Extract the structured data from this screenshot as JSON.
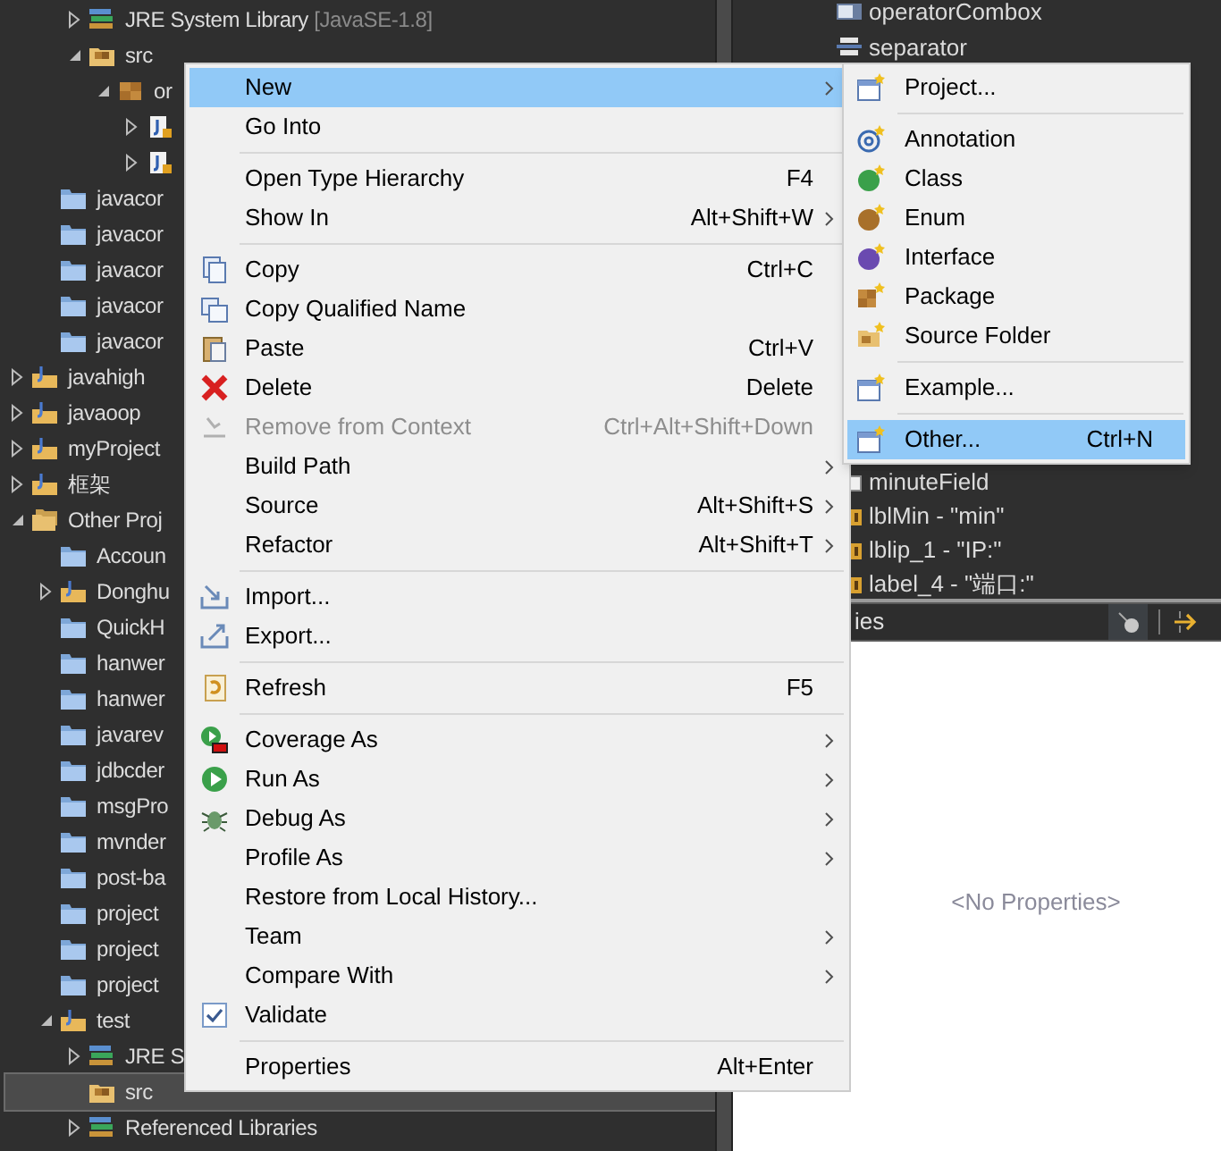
{
  "package_explorer": {
    "tree": [
      {
        "children": [
          {
            "children": [
              {
                "kind": "library",
                "label": "JRE System Library",
                "decoration": "[JavaSE-1.8]",
                "expanded": false,
                "selected": false
              },
              {
                "kind": "source-folder",
                "label": "src",
                "expanded": true,
                "selected": false,
                "children": [
                  {
                    "kind": "package",
                    "label": "or",
                    "expanded": true,
                    "selected": false,
                    "children": [
                      {
                        "kind": "file",
                        "expanded": false,
                        "selected": false
                      },
                      {
                        "kind": "file",
                        "expanded": false,
                        "selected": false
                      }
                    ]
                  }
                ]
              }
            ]
          },
          {
            "kind": "folder",
            "label": "javacor",
            "selected": false
          },
          {
            "kind": "folder",
            "label": "javacor",
            "selected": false
          },
          {
            "kind": "folder",
            "label": "javacor",
            "selected": false
          },
          {
            "kind": "folder",
            "label": "javacor",
            "selected": false
          },
          {
            "kind": "folder",
            "label": "javacor",
            "selected": false
          }
        ]
      },
      {
        "kind": "project",
        "label": "javahigh",
        "expanded": false,
        "selected": false
      },
      {
        "kind": "project",
        "label": "javaoop",
        "expanded": false,
        "selected": false
      },
      {
        "kind": "project",
        "label": "myProject",
        "expanded": false,
        "selected": false
      },
      {
        "kind": "project",
        "label": "框架",
        "expanded": false,
        "selected": false
      },
      {
        "kind": "working-set",
        "label": "Other Proj",
        "expanded": true,
        "selected": false,
        "children": [
          {
            "kind": "folder",
            "label": "Accoun",
            "selected": false
          },
          {
            "kind": "project",
            "label": "Donghu",
            "expanded": false,
            "selected": false
          },
          {
            "kind": "folder",
            "label": "QuickH",
            "selected": false
          },
          {
            "kind": "folder",
            "label": "hanwer",
            "selected": false
          },
          {
            "kind": "folder",
            "label": "hanwer",
            "selected": false
          },
          {
            "kind": "folder",
            "label": "javarev",
            "selected": false
          },
          {
            "kind": "folder",
            "label": "jdbcder",
            "selected": false
          },
          {
            "kind": "folder",
            "label": "msgPro",
            "selected": false
          },
          {
            "kind": "folder",
            "label": "mvnder",
            "selected": false
          },
          {
            "kind": "folder",
            "label": "post-ba",
            "selected": false
          },
          {
            "kind": "folder",
            "label": "project",
            "selected": false
          },
          {
            "kind": "folder",
            "label": "project",
            "selected": false
          },
          {
            "kind": "folder",
            "label": "project",
            "selected": false
          },
          {
            "kind": "project",
            "label": "test",
            "expanded": true,
            "selected": false,
            "children": [
              {
                "kind": "library",
                "label": "JRE S",
                "expanded": false,
                "selected": false
              },
              {
                "kind": "source-folder",
                "label": "src",
                "selected": true
              },
              {
                "kind": "library",
                "label": "Referenced Libraries",
                "expanded": false,
                "selected": false
              }
            ]
          }
        ]
      }
    ]
  },
  "outline": {
    "top_items": [
      {
        "kind": "combo",
        "label": "operatorCombox"
      },
      {
        "kind": "separator",
        "label": "separator"
      }
    ],
    "bottom_items": [
      {
        "kind": "field",
        "label": "minuteField"
      },
      {
        "kind": "label",
        "label": "lblMin - \"min\""
      },
      {
        "kind": "label",
        "label": "lblip_1 - \"IP:\""
      },
      {
        "kind": "label",
        "label": "label_4 - \"端口:\""
      }
    ]
  },
  "properties_view": {
    "tab": "ies",
    "empty_message": "<No Properties>"
  },
  "context_menu": {
    "items": [
      {
        "kind": "item",
        "label": "New",
        "submenu": true,
        "selected": true,
        "disabled": false
      },
      {
        "kind": "item",
        "label": "Go Into",
        "submenu": false,
        "selected": false,
        "disabled": false
      },
      {
        "kind": "separator"
      },
      {
        "kind": "item",
        "label": "Open Type Hierarchy",
        "shortcut": "F4",
        "submenu": false,
        "selected": false,
        "disabled": false
      },
      {
        "kind": "item",
        "label": "Show In",
        "shortcut": "Alt+Shift+W",
        "submenu": true,
        "selected": false,
        "disabled": false
      },
      {
        "kind": "separator"
      },
      {
        "kind": "item",
        "label": "Copy",
        "shortcut": "Ctrl+C",
        "submenu": false,
        "selected": false,
        "disabled": false
      },
      {
        "kind": "item",
        "label": "Copy Qualified Name",
        "submenu": false,
        "selected": false,
        "disabled": false
      },
      {
        "kind": "item",
        "label": "Paste",
        "shortcut": "Ctrl+V",
        "submenu": false,
        "selected": false,
        "disabled": false
      },
      {
        "kind": "item",
        "label": "Delete",
        "shortcut": "Delete",
        "submenu": false,
        "selected": false,
        "disabled": false
      },
      {
        "kind": "item",
        "label": "Remove from Context",
        "shortcut": "Ctrl+Alt+Shift+Down",
        "submenu": false,
        "selected": false,
        "disabled": true
      },
      {
        "kind": "item",
        "label": "Build Path",
        "submenu": true,
        "selected": false,
        "disabled": false
      },
      {
        "kind": "item",
        "label": "Source",
        "shortcut": "Alt+Shift+S",
        "submenu": true,
        "selected": false,
        "disabled": false
      },
      {
        "kind": "item",
        "label": "Refactor",
        "shortcut": "Alt+Shift+T",
        "submenu": true,
        "selected": false,
        "disabled": false
      },
      {
        "kind": "separator"
      },
      {
        "kind": "item",
        "label": "Import...",
        "submenu": false,
        "selected": false,
        "disabled": false
      },
      {
        "kind": "item",
        "label": "Export...",
        "submenu": false,
        "selected": false,
        "disabled": false
      },
      {
        "kind": "separator"
      },
      {
        "kind": "item",
        "label": "Refresh",
        "shortcut": "F5",
        "submenu": false,
        "selected": false,
        "disabled": false
      },
      {
        "kind": "separator"
      },
      {
        "kind": "item",
        "label": "Coverage As",
        "submenu": true,
        "selected": false,
        "disabled": false
      },
      {
        "kind": "item",
        "label": "Run As",
        "submenu": true,
        "selected": false,
        "disabled": false
      },
      {
        "kind": "item",
        "label": "Debug As",
        "submenu": true,
        "selected": false,
        "disabled": false
      },
      {
        "kind": "item",
        "label": "Profile As",
        "submenu": true,
        "selected": false,
        "disabled": false
      },
      {
        "kind": "item",
        "label": "Restore from Local History...",
        "submenu": false,
        "selected": false,
        "disabled": false
      },
      {
        "kind": "item",
        "label": "Team",
        "submenu": true,
        "selected": false,
        "disabled": false
      },
      {
        "kind": "item",
        "label": "Compare With",
        "submenu": true,
        "selected": false,
        "disabled": false
      },
      {
        "kind": "check",
        "label": "Validate",
        "checked": true,
        "submenu": false,
        "selected": false,
        "disabled": false
      },
      {
        "kind": "separator"
      },
      {
        "kind": "item",
        "label": "Properties",
        "shortcut": "Alt+Enter",
        "submenu": false,
        "selected": false,
        "disabled": false
      }
    ]
  },
  "new_submenu": {
    "items": [
      {
        "kind": "item",
        "label": "Project...",
        "selected": false
      },
      {
        "kind": "separator"
      },
      {
        "kind": "item",
        "label": "Annotation",
        "selected": false
      },
      {
        "kind": "item",
        "label": "Class",
        "selected": false
      },
      {
        "kind": "item",
        "label": "Enum",
        "selected": false
      },
      {
        "kind": "item",
        "label": "Interface",
        "selected": false
      },
      {
        "kind": "item",
        "label": "Package",
        "selected": false
      },
      {
        "kind": "item",
        "label": "Source Folder",
        "selected": false
      },
      {
        "kind": "separator"
      },
      {
        "kind": "item",
        "label": "Example...",
        "selected": false
      },
      {
        "kind": "separator"
      },
      {
        "kind": "item",
        "label": "Other...",
        "shortcut": "Ctrl+N",
        "selected": true
      }
    ]
  }
}
